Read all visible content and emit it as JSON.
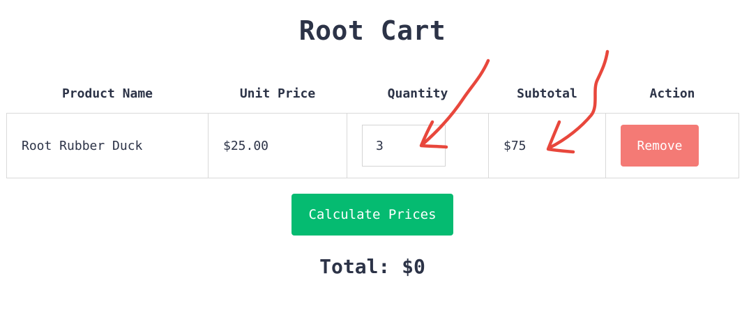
{
  "title": "Root Cart",
  "table": {
    "headers": {
      "product_name": "Product Name",
      "unit_price": "Unit Price",
      "quantity": "Quantity",
      "subtotal": "Subtotal",
      "action": "Action"
    },
    "rows": [
      {
        "product_name": "Root Rubber Duck",
        "unit_price": "$25.00",
        "quantity": "3",
        "subtotal": "$75",
        "action_label": "Remove"
      }
    ]
  },
  "calculate_label": "Calculate Prices",
  "total_text": "Total: $0",
  "colors": {
    "remove_button": "#f47a75",
    "calculate_button": "#05bb71",
    "annotation_arrows": "#e8473c",
    "text": "#2c3347"
  },
  "annotations": [
    {
      "kind": "hand-drawn-arrow",
      "target": "quantity-input"
    },
    {
      "kind": "hand-drawn-arrow",
      "target": "subtotal-cell"
    }
  ]
}
